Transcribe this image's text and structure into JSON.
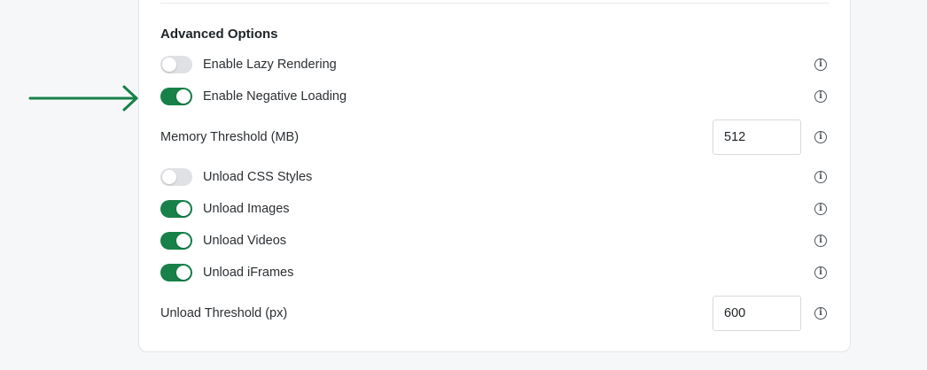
{
  "section": {
    "title": "Advanced Options"
  },
  "options": {
    "lazy_rendering": {
      "label": "Enable Lazy Rendering",
      "enabled": false
    },
    "negative_loading": {
      "label": "Enable Negative Loading",
      "enabled": true
    },
    "memory_threshold": {
      "label": "Memory Threshold (MB)",
      "value": "512"
    },
    "unload_css": {
      "label": "Unload CSS Styles",
      "enabled": false
    },
    "unload_images": {
      "label": "Unload Images",
      "enabled": true
    },
    "unload_videos": {
      "label": "Unload Videos",
      "enabled": true
    },
    "unload_iframes": {
      "label": "Unload iFrames",
      "enabled": true
    },
    "unload_threshold": {
      "label": "Unload Threshold (px)",
      "value": "600"
    }
  },
  "colors": {
    "toggle_on": "#178148",
    "toggle_off": "#dfe1e4",
    "arrow": "#178148"
  },
  "icons": {
    "info": "info-icon",
    "arrow": "arrow-right-icon"
  }
}
